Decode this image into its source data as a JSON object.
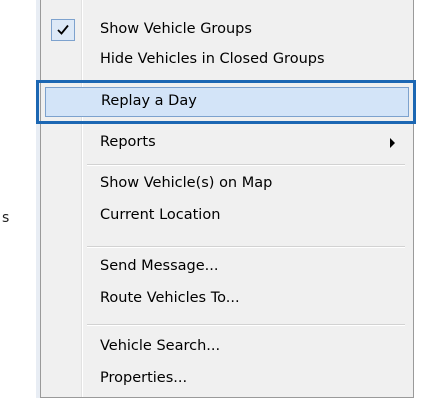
{
  "menu": {
    "items": [
      {
        "label": "Show Vehicle Groups",
        "checked": true
      },
      {
        "label": "Hide Vehicles in Closed Groups"
      },
      {
        "label": "Replay a Day",
        "selected": true
      },
      {
        "label": "Reports",
        "submenu": true
      },
      {
        "label": "Show Vehicle(s) on Map"
      },
      {
        "label": "Current Location"
      },
      {
        "label": "Send Message..."
      },
      {
        "label": "Route Vehicles To..."
      },
      {
        "label": "Vehicle Search..."
      },
      {
        "label": "Properties..."
      }
    ]
  },
  "background": {
    "stray_text": "s"
  },
  "colors": {
    "selection_fill": "#d3e4f8",
    "selection_border": "#7da2ce",
    "callout_border": "#1c67b3",
    "menu_background": "#f0f0f0"
  },
  "icons": {
    "check": "checkmark-icon",
    "submenu": "submenu-arrow-icon"
  }
}
